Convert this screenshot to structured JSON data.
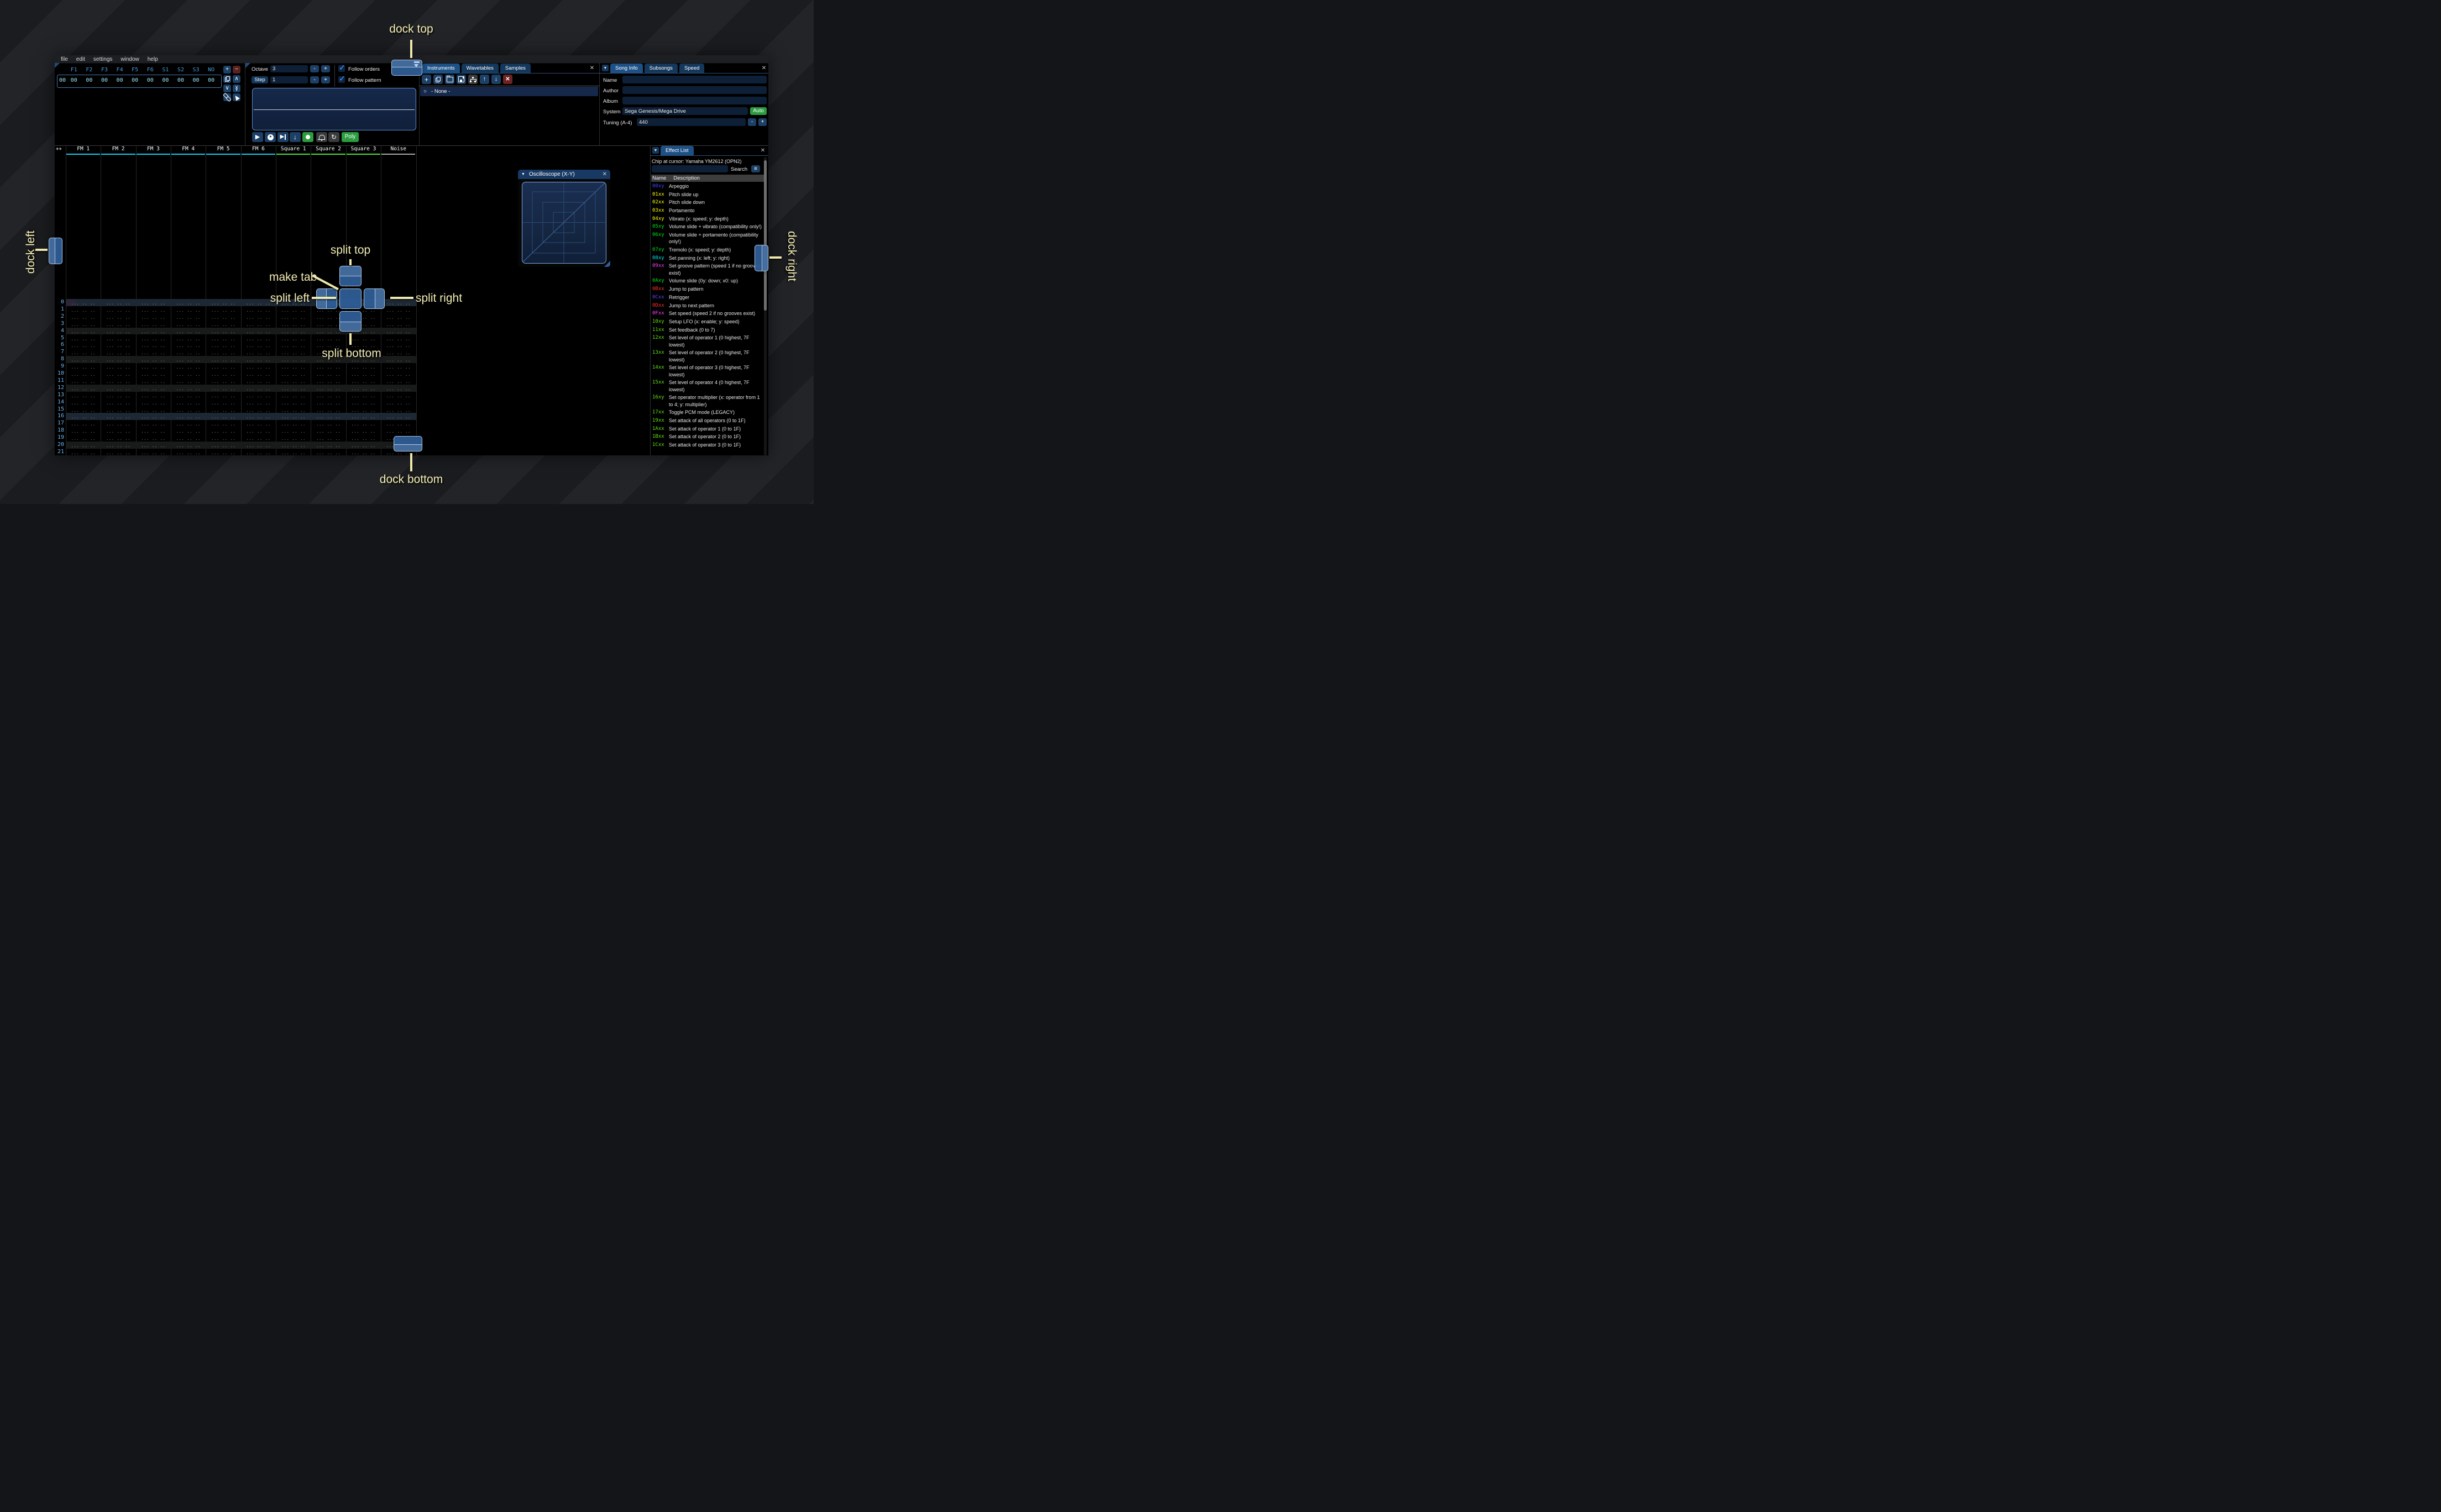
{
  "window": {
    "menu": [
      "file",
      "edit",
      "settings",
      "window",
      "help"
    ]
  },
  "orders": {
    "row_number": "00",
    "columns": [
      "F1",
      "F2",
      "F3",
      "F4",
      "F5",
      "F6",
      "S1",
      "S2",
      "S3",
      "NO"
    ],
    "row_values": [
      "00",
      "00",
      "00",
      "00",
      "00",
      "00",
      "00",
      "00",
      "00",
      "00"
    ]
  },
  "edit_controls": {
    "octave_label": "Octave",
    "octave_value": "3",
    "step_label": "Step",
    "step_value": "1",
    "minus": "-",
    "plus": "+",
    "follow_orders": "Follow orders",
    "follow_pattern": "Follow pattern",
    "poly": "Poly"
  },
  "instruments": {
    "tabs": [
      "Instruments",
      "Wavetables",
      "Samples"
    ],
    "active_tab": "Instruments",
    "selected_item": "- None -"
  },
  "song_info": {
    "tabs": [
      "Song Info",
      "Subsongs",
      "Speed"
    ],
    "active_tab": "Song Info",
    "name_label": "Name",
    "name_value": "",
    "author_label": "Author",
    "author_value": "",
    "album_label": "Album",
    "album_value": "",
    "system_label": "System",
    "system_value": "Sega Genesis/Mega Drive",
    "auto_button": "Auto",
    "tuning_label": "Tuning (A-4)",
    "tuning_value": "440"
  },
  "pattern": {
    "corner_button": "++",
    "channels": [
      {
        "label": "FM 1",
        "type": "fm"
      },
      {
        "label": "FM 2",
        "type": "fm"
      },
      {
        "label": "FM 3",
        "type": "fm"
      },
      {
        "label": "FM 4",
        "type": "fm"
      },
      {
        "label": "FM 5",
        "type": "fm"
      },
      {
        "label": "FM 6",
        "type": "fm"
      },
      {
        "label": "Square 1",
        "type": "square"
      },
      {
        "label": "Square 2",
        "type": "square"
      },
      {
        "label": "Square 3",
        "type": "square"
      },
      {
        "label": "Noise",
        "type": "noise"
      }
    ],
    "row_numbers": [
      "0",
      "1",
      "2",
      "3",
      "4",
      "5",
      "6",
      "7",
      "8",
      "9",
      "10",
      "11",
      "12",
      "13",
      "14",
      "15",
      "16",
      "17",
      "18",
      "19",
      "20",
      "21"
    ],
    "empty_cell": "... .. .. ....",
    "highlight_every": 4,
    "strong_highlight_every": 16
  },
  "oscilloscope": {
    "title": "Oscilloscope (X-Y)"
  },
  "effect_list": {
    "tab": "Effect List",
    "chip_at_cursor": "Chip at cursor: Yamaha YM2612 (OPN2)",
    "search_button": "Search",
    "name_header": "Name",
    "description_header": "Description",
    "effects": [
      {
        "code": "00xy",
        "desc": "Arpeggio",
        "color": "#4343ff"
      },
      {
        "code": "01xx",
        "desc": "Pitch slide up",
        "color": "#ffff00"
      },
      {
        "code": "02xx",
        "desc": "Pitch slide down",
        "color": "#ffff00"
      },
      {
        "code": "03xx",
        "desc": "Portamento",
        "color": "#ffff00"
      },
      {
        "code": "04xy",
        "desc": "Vibrato (x: speed; y: depth)",
        "color": "#ffff00"
      },
      {
        "code": "05xy",
        "desc": "Volume slide + vibrato (compatibility only!)",
        "color": "#00e515"
      },
      {
        "code": "06xy",
        "desc": "Volume slide + portamento (compatibility only!)",
        "color": "#00e515"
      },
      {
        "code": "07xy",
        "desc": "Tremolo (x: speed; y: depth)",
        "color": "#00e515"
      },
      {
        "code": "08xy",
        "desc": "Set panning (x: left; y: right)",
        "color": "#00e5e5"
      },
      {
        "code": "09xx",
        "desc": "Set groove pattern (speed 1 if no grooves exist)",
        "color": "#ff40ff"
      },
      {
        "code": "0Axy",
        "desc": "Volume slide (0y: down; x0: up)",
        "color": "#00e515"
      },
      {
        "code": "0Bxx",
        "desc": "Jump to pattern",
        "color": "#ff3030"
      },
      {
        "code": "0Cxx",
        "desc": "Retrigger",
        "color": "#5b45ff"
      },
      {
        "code": "0Dxx",
        "desc": "Jump to next pattern",
        "color": "#ff3030"
      },
      {
        "code": "0Fxx",
        "desc": "Set speed (speed 2 if no grooves exist)",
        "color": "#ff40ff"
      },
      {
        "code": "10xy",
        "desc": "Setup LFO (x: enable; y: speed)",
        "color": "#61e616"
      },
      {
        "code": "11xx",
        "desc": "Set feedback (0 to 7)",
        "color": "#61e616"
      },
      {
        "code": "12xx",
        "desc": "Set level of operator 1 (0 highest, 7F lowest)",
        "color": "#61e616"
      },
      {
        "code": "13xx",
        "desc": "Set level of operator 2 (0 highest, 7F lowest)",
        "color": "#61e616"
      },
      {
        "code": "14xx",
        "desc": "Set level of operator 3 (0 highest, 7F lowest)",
        "color": "#61e616"
      },
      {
        "code": "15xx",
        "desc": "Set level of operator 4 (0 highest, 7F lowest)",
        "color": "#61e616"
      },
      {
        "code": "16xy",
        "desc": "Set operator multiplier (x: operator from 1 to 4; y: multiplier)",
        "color": "#61e616"
      },
      {
        "code": "17xx",
        "desc": "Toggle PCM mode (LEGACY)",
        "color": "#61e616"
      },
      {
        "code": "19xx",
        "desc": "Set attack of all operators (0 to 1F)",
        "color": "#61e616"
      },
      {
        "code": "1Axx",
        "desc": "Set attack of operator 1 (0 to 1F)",
        "color": "#61e616"
      },
      {
        "code": "1Bxx",
        "desc": "Set attack of operator 2 (0 to 1F)",
        "color": "#61e616"
      },
      {
        "code": "1Cxx",
        "desc": "Set attack of operator 3 (0 to 1F)",
        "color": "#61e616"
      }
    ]
  },
  "docking": {
    "labels": {
      "dock_top": "dock top",
      "dock_bottom": "dock bottom",
      "dock_left": "dock left",
      "dock_right": "dock right",
      "split_top": "split top",
      "split_bottom": "split bottom",
      "split_left": "split left",
      "split_right": "split right",
      "make_tab": "make tab"
    }
  },
  "icons": {
    "plus": "+",
    "minus": "−",
    "chevron_up": "∧",
    "chevron_down": "∨",
    "arrow_up": "↑",
    "arrow_down": "↓",
    "close": "✕",
    "collapse_triangle": "▼",
    "circle": "○",
    "hamburger": "≡",
    "checkmark": "✓",
    "play": "▶",
    "repeat": "↻"
  },
  "colors": {
    "annotation": "#f3edb4",
    "fm_channel": "#12cdee",
    "square_channel": "#4fe03a",
    "noise_channel": "#a8a8a8",
    "tab_active": "#1d5186",
    "tab_inactive": "#14375c",
    "accent_green": "#2c9c40",
    "dock_overlay": "#2e5d96"
  }
}
